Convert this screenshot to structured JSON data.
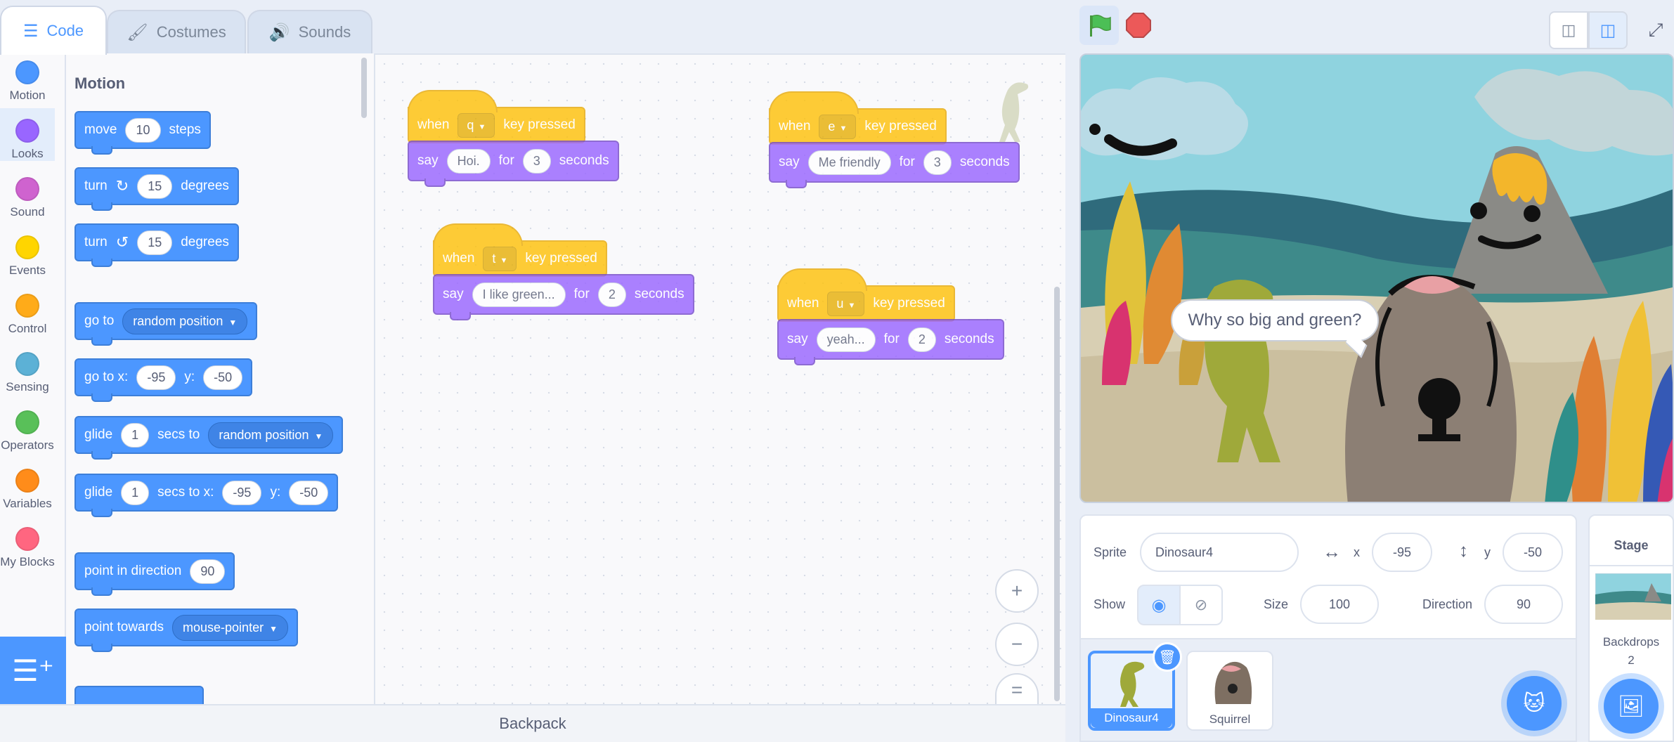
{
  "tabs": [
    {
      "label": "Code",
      "icon": "code-icon"
    },
    {
      "label": "Costumes",
      "icon": "brush-icon"
    },
    {
      "label": "Sounds",
      "icon": "speaker-icon"
    }
  ],
  "categories": [
    {
      "label": "Motion",
      "color": "#4c97ff"
    },
    {
      "label": "Looks",
      "color": "#9966ff"
    },
    {
      "label": "Sound",
      "color": "#cf63cf"
    },
    {
      "label": "Events",
      "color": "#ffd500"
    },
    {
      "label": "Control",
      "color": "#ffab19"
    },
    {
      "label": "Sensing",
      "color": "#5cb1d6"
    },
    {
      "label": "Operators",
      "color": "#59c059"
    },
    {
      "label": "Variables",
      "color": "#ff8c1a"
    },
    {
      "label": "My Blocks",
      "color": "#ff6680"
    }
  ],
  "palette": {
    "heading": "Motion",
    "move": {
      "a": "move",
      "v": "10",
      "b": "steps"
    },
    "turn_right": {
      "a": "turn",
      "v": "15",
      "b": "degrees"
    },
    "turn_left": {
      "a": "turn",
      "v": "15",
      "b": "degrees"
    },
    "goto": {
      "a": "go to",
      "dd": "random position"
    },
    "gotoxy": {
      "a": "go to x:",
      "x": "-95",
      "b": "y:",
      "y": "-50"
    },
    "glide_to": {
      "a": "glide",
      "v": "1",
      "b": "secs to",
      "dd": "random position"
    },
    "glide_xy": {
      "a": "glide",
      "v": "1",
      "b": "secs to x:",
      "x": "-95",
      "c": "y:",
      "y": "-50"
    },
    "point_dir": {
      "a": "point in direction",
      "v": "90"
    },
    "point_towards": {
      "a": "point towards",
      "dd": "mouse-pointer"
    }
  },
  "scripts": [
    {
      "when": "when",
      "key": "q",
      "pressed": "key pressed",
      "say": "say",
      "text": "Hoi.",
      "for": "for",
      "secs": "3",
      "seconds": "seconds"
    },
    {
      "when": "when",
      "key": "e",
      "pressed": "key pressed",
      "say": "say",
      "text": "Me friendly",
      "for": "for",
      "secs": "3",
      "seconds": "seconds"
    },
    {
      "when": "when",
      "key": "t",
      "pressed": "key pressed",
      "say": "say",
      "text": "I like green...",
      "for": "for",
      "secs": "2",
      "seconds": "seconds"
    },
    {
      "when": "when",
      "key": "u",
      "pressed": "key pressed",
      "say": "say",
      "text": "yeah...",
      "for": "for",
      "secs": "2",
      "seconds": "seconds"
    }
  ],
  "zoom": {
    "in": "+",
    "out": "−",
    "reset": "="
  },
  "backpack": "Backpack",
  "stage": {
    "speech": "Why so big and green?"
  },
  "sprite_info": {
    "sprite_label": "Sprite",
    "sprite_name": "Dinosaur4",
    "x_label": "x",
    "x": "-95",
    "y_label": "y",
    "y": "-50",
    "show_label": "Show",
    "size_label": "Size",
    "size": "100",
    "direction_label": "Direction",
    "direction": "90"
  },
  "sprites": [
    {
      "name": "Dinosaur4",
      "selected": true
    },
    {
      "name": "Squirrel",
      "selected": false
    }
  ],
  "stage_panel": {
    "title": "Stage",
    "backdrops_label": "Backdrops",
    "backdrops_count": "2"
  }
}
